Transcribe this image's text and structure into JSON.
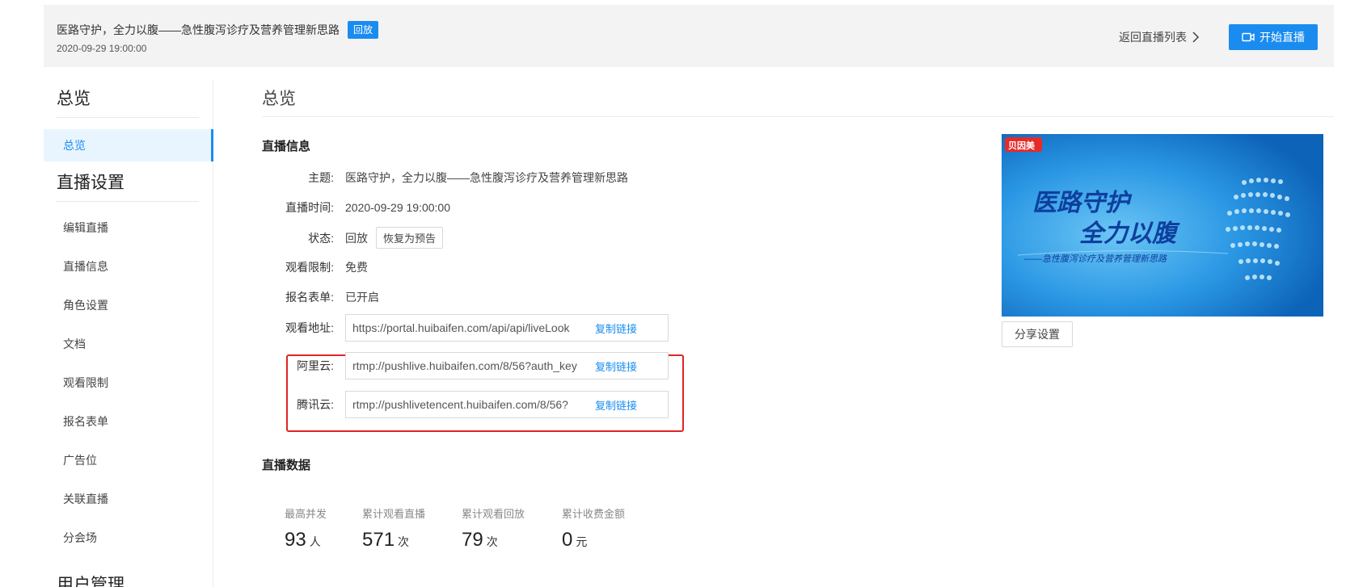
{
  "header": {
    "title": "医路守护，全力以腹——急性腹泻诊疗及营养管理新思路",
    "badge": "回放",
    "date": "2020-09-29 19:00:00",
    "back_label": "返回直播列表",
    "start_label": "开始直播"
  },
  "sidebar": {
    "sections": [
      {
        "title": "总览",
        "items": [
          {
            "label": "总览",
            "active": true
          }
        ]
      },
      {
        "title": "直播设置",
        "items": [
          {
            "label": "编辑直播"
          },
          {
            "label": "直播信息"
          },
          {
            "label": "角色设置"
          },
          {
            "label": "文档"
          },
          {
            "label": "观看限制"
          },
          {
            "label": "报名表单"
          },
          {
            "label": "广告位"
          },
          {
            "label": "关联直播"
          },
          {
            "label": "分会场"
          }
        ]
      },
      {
        "title": "用户管理",
        "items": []
      }
    ]
  },
  "main": {
    "title": "总览",
    "info_title": "直播信息",
    "subject_label": "主题:",
    "subject": "医路守护，全力以腹——急性腹泻诊疗及营养管理新思路",
    "time_label": "直播时间:",
    "time": "2020-09-29 19:00:00",
    "status_label": "状态:",
    "status": "回放",
    "restore_label": "恢复为预告",
    "limit_label": "观看限制:",
    "limit": "免费",
    "form_label": "报名表单:",
    "form": "已开启",
    "watch_label": "观看地址:",
    "watch_url": "https://portal.huibaifen.com/api/api/liveLook",
    "aliyun_label": "阿里云:",
    "aliyun_url": "rtmp://pushlive.huibaifen.com/8/56?auth_key",
    "tencent_label": "腾讯云:",
    "tencent_url": "rtmp://pushlivetencent.huibaifen.com/8/56?",
    "copy_label": "复制链接",
    "data_title": "直播数据",
    "stats": [
      {
        "label": "最高并发",
        "value": "93",
        "unit": "人"
      },
      {
        "label": "累计观看直播",
        "value": "571",
        "unit": "次"
      },
      {
        "label": "累计观看回放",
        "value": "79",
        "unit": "次"
      },
      {
        "label": "累计收费金额",
        "value": "0",
        "unit": "元"
      }
    ]
  },
  "poster": {
    "logo": "贝因美",
    "line1": "医路守护",
    "line2": "全力以腹",
    "subtitle": "——急性腹泻诊疗及营养管理新思路",
    "share_label": "分享设置"
  },
  "colors": {
    "accent": "#1a8cf0",
    "highlight": "#e02424"
  }
}
